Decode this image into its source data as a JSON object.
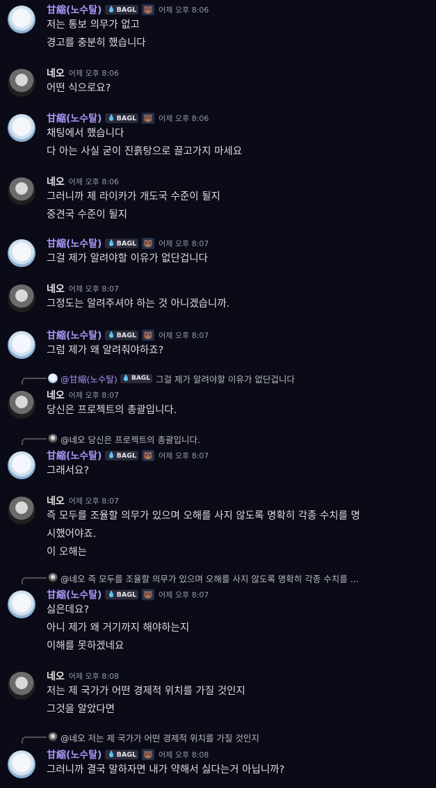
{
  "users": {
    "gan": {
      "name": "甘縮(노수탈)",
      "tag": "BAGL",
      "badge_icon": "bear-icon"
    },
    "neo": {
      "name": "네오"
    }
  },
  "messages": [
    {
      "author": "gan",
      "time": "어제 오후 8:06",
      "lines": [
        "저는 통보 의무가 없고",
        "경고를 충분히 했습니다"
      ]
    },
    {
      "author": "neo",
      "time": "어제 오후 8:06",
      "lines": [
        "어떤 식으로요?"
      ]
    },
    {
      "author": "gan",
      "time": "어제 오후 8:06",
      "lines": [
        "채팅에서 했습니다",
        "다 아는 사실 굳이 진흙탕으로 끌고가지 마세요"
      ]
    },
    {
      "author": "neo",
      "time": "어제 오후 8:06",
      "lines": [
        "그러니까 제 라이카가 개도국 수준이 될지",
        "중견국 수준이 될지"
      ]
    },
    {
      "author": "gan",
      "time": "어제 오후 8:07",
      "lines": [
        "그걸 제가 알려야할 이유가 없단겁니다"
      ]
    },
    {
      "author": "neo",
      "time": "어제 오후 8:07",
      "lines": [
        "그정도는 알려주셔야 하는 것 아니겠습니까."
      ]
    },
    {
      "author": "gan",
      "time": "어제 오후 8:07",
      "lines": [
        "그럼 제가 왜 알려줘야하죠?"
      ]
    },
    {
      "author": "neo",
      "time": "어제 오후 8:07",
      "lines": [
        "당신은 프로젝트의 총괄입니다."
      ],
      "reply": {
        "author": "gan",
        "mention": "@甘縮(노수탈)",
        "tag": "BAGL",
        "text": "그걸 제가 알려야할 이유가 없단겁니다"
      }
    },
    {
      "author": "gan",
      "time": "어제 오후 8:07",
      "lines": [
        "그래서요?"
      ],
      "reply": {
        "author": "neo",
        "mention": "@네오",
        "text": "당신은 프로젝트의 총괄입니다."
      }
    },
    {
      "author": "neo",
      "time": "어제 오후 8:07",
      "lines": [
        "즉 모두를 조율할 의무가 있으며 오해를 사지 않도록 명확히 각종 수치를 명",
        "시했어야죠.",
        "이 오해는"
      ]
    },
    {
      "author": "gan",
      "time": "어제 오후 8:07",
      "lines": [
        "싫은데요?",
        "아니 제가 왜 거기까지 해야하는지",
        "이해를 못하겠네요"
      ],
      "reply": {
        "author": "neo",
        "mention": "@네오",
        "text": "즉 모두를 조율할 의무가 있으며 오해를 사지 않도록 명확히 각종 수치를 ..."
      }
    },
    {
      "author": "neo",
      "time": "어제 오후 8:08",
      "lines": [
        "저는 제 국가가 어떤 경제적 위치를 가질 것인지",
        "그것을 알았다면"
      ]
    },
    {
      "author": "gan",
      "time": "어제 오후 8:08",
      "lines": [
        "그러니까 결국 말하자면 내가 약해서 싫다는거 아닙니까?"
      ],
      "reply": {
        "author": "neo",
        "mention": "@네오",
        "text": "저는 제 국가가 어떤 경제적 위치를 가질 것인지"
      }
    }
  ]
}
